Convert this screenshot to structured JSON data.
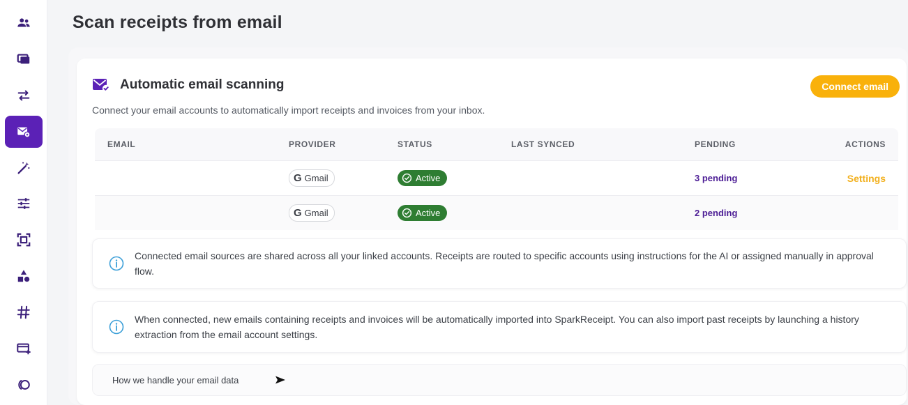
{
  "page": {
    "title": "Scan receipts from email"
  },
  "sidebar": {
    "items": [
      {
        "icon": "users-icon"
      },
      {
        "icon": "receipts-icon"
      },
      {
        "icon": "transfer-arrows-icon"
      },
      {
        "icon": "email-receipt-icon",
        "active": true
      },
      {
        "icon": "magic-wand-icon"
      },
      {
        "icon": "sliders-icon"
      },
      {
        "icon": "scan-frame-icon"
      },
      {
        "icon": "shapes-icon"
      },
      {
        "icon": "hashtag-icon"
      },
      {
        "icon": "card-add-icon"
      },
      {
        "icon": "toggle-circle-icon"
      }
    ]
  },
  "card": {
    "title": "Automatic email scanning",
    "connect_button": "Connect email",
    "description": "Connect your email accounts to automatically import receipts and invoices from your inbox."
  },
  "table": {
    "headers": [
      "EMAIL",
      "PROVIDER",
      "STATUS",
      "LAST SYNCED",
      "PENDING",
      "ACTIONS"
    ],
    "rows": [
      {
        "email": "",
        "provider": "Gmail",
        "status": "Active",
        "last_synced": "",
        "pending": "3 pending",
        "action": "Settings"
      },
      {
        "email": "",
        "provider": "Gmail",
        "status": "Active",
        "last_synced": "",
        "pending": "2 pending",
        "action": ""
      }
    ]
  },
  "info": {
    "shared": "Connected email sources are shared across all your linked accounts. Receipts are routed to specific accounts using instructions for the AI or assigned manually in approval flow.",
    "auto_import": "When connected, new emails containing receipts and invoices will be automatically imported into SparkReceipt. You can also import past receipts by launching a history extraction from the email account settings."
  },
  "data_handling": {
    "label": "How we handle your email data"
  },
  "colors": {
    "accent": "#5b21b6",
    "button": "#f9b10b",
    "active_badge": "#2e7d32",
    "pending_text": "#4c1d95",
    "settings_link": "#f2b01e",
    "info_icon": "#3b9fd8"
  }
}
